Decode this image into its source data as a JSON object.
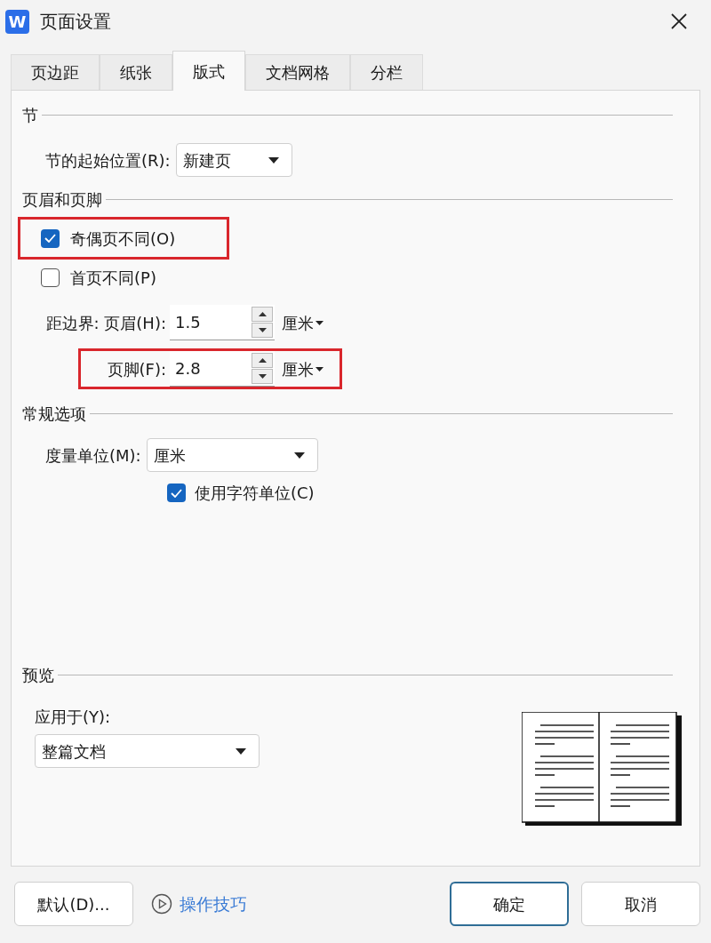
{
  "window": {
    "app_icon_letter": "W",
    "title": "页面设置"
  },
  "tabs": [
    {
      "label": "页边距",
      "selected": false
    },
    {
      "label": "纸张",
      "selected": false
    },
    {
      "label": "版式",
      "selected": true
    },
    {
      "label": "文档网格",
      "selected": false
    },
    {
      "label": "分栏",
      "selected": false
    }
  ],
  "section": {
    "title": "节",
    "start_label": "节的起始位置(R):",
    "start_value": "新建页"
  },
  "header_footer": {
    "title": "页眉和页脚",
    "options": [
      {
        "label": "奇偶页不同(O)",
        "checked": true,
        "highlighted": true
      },
      {
        "label": "首页不同(P)",
        "checked": false,
        "highlighted": false
      }
    ],
    "fields": [
      {
        "label": "距边界: 页眉(H):",
        "value": "1.5",
        "unit": "厘米",
        "highlighted": false
      },
      {
        "label": "页脚(F):",
        "value": "2.8",
        "unit": "厘米",
        "highlighted": true
      }
    ]
  },
  "general": {
    "title": "常规选项",
    "unit_label": "度量单位(M):",
    "unit_value": "厘米",
    "char_unit": {
      "label": "使用字符单位(C)",
      "checked": true
    }
  },
  "preview": {
    "title": "预览",
    "apply_label": "应用于(Y):",
    "apply_value": "整篇文档"
  },
  "buttons": [
    {
      "kind": "button",
      "label": "默认(D)..."
    },
    {
      "kind": "link",
      "label": "操作技巧"
    },
    {
      "kind": "primary",
      "label": "确定"
    },
    {
      "kind": "button",
      "label": "取消"
    }
  ]
}
